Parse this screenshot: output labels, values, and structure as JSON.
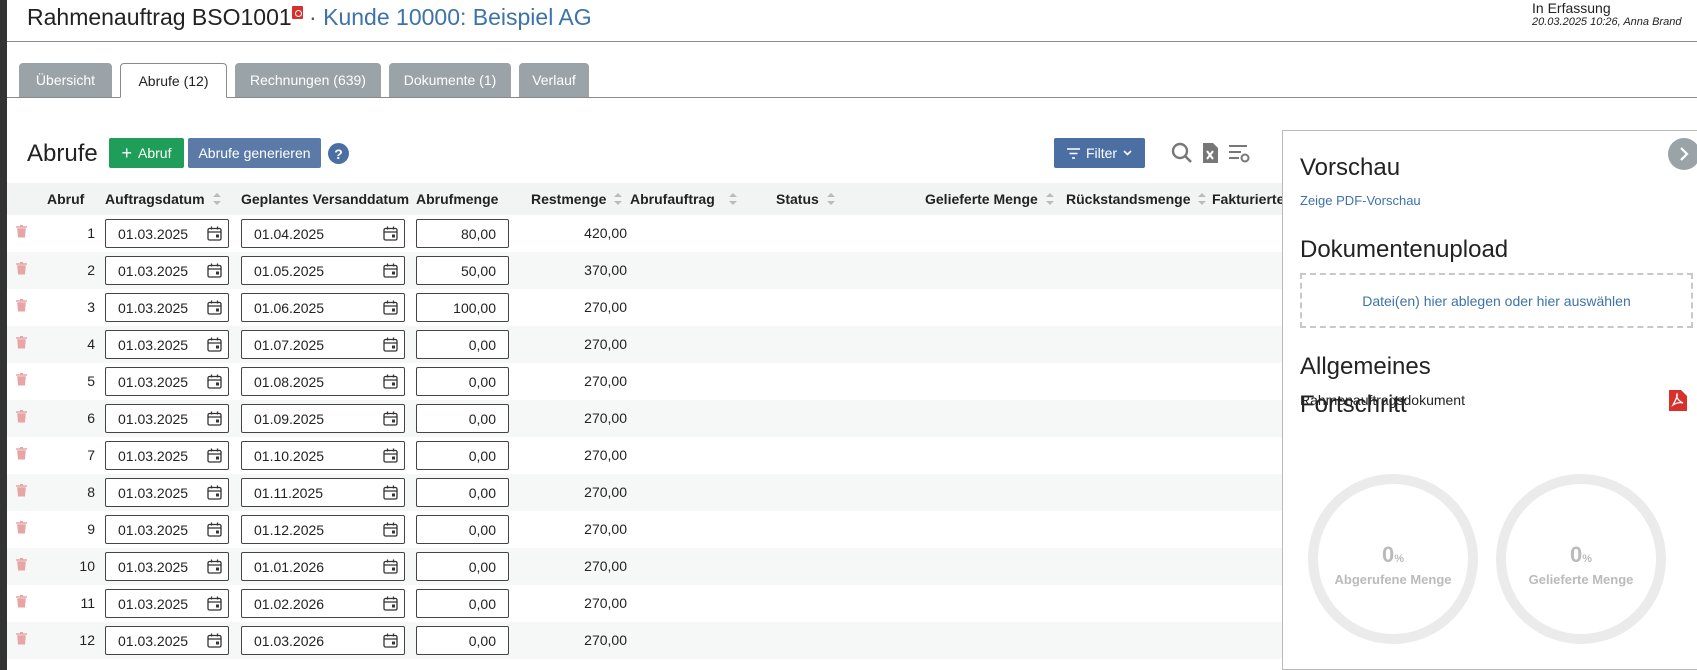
{
  "header": {
    "title": "Rahmenauftrag BSO1001",
    "separator": " · ",
    "customer": "Kunde 10000: Beispiel AG",
    "status": "In Erfassung",
    "meta": "20.03.2025 10:26, Anna Brand"
  },
  "tabs": [
    {
      "label": "Übersicht",
      "active": false
    },
    {
      "label": "Abrufe (12)",
      "active": true
    },
    {
      "label": "Rechnungen (639)",
      "active": false
    },
    {
      "label": "Dokumente (1)",
      "active": false
    },
    {
      "label": "Verlauf",
      "active": false
    }
  ],
  "toolbar": {
    "section_title": "Abrufe",
    "add_label": "Abruf",
    "generate_label": "Abrufe generieren",
    "help_label": "?",
    "filter_label": "Filter"
  },
  "table": {
    "columns": [
      "Abruf",
      "Auftragsdatum",
      "Geplantes Versanddatum",
      "Abrufmenge",
      "Restmenge",
      "Abrufauftrag",
      "Status",
      "Gelieferte Menge",
      "Rückstandsmenge",
      "Fakturierte"
    ],
    "rows": [
      {
        "nr": "1",
        "auftragsdatum": "01.03.2025",
        "versanddatum": "01.04.2025",
        "abrufmenge": "80,00",
        "restmenge": "420,00"
      },
      {
        "nr": "2",
        "auftragsdatum": "01.03.2025",
        "versanddatum": "01.05.2025",
        "abrufmenge": "50,00",
        "restmenge": "370,00"
      },
      {
        "nr": "3",
        "auftragsdatum": "01.03.2025",
        "versanddatum": "01.06.2025",
        "abrufmenge": "100,00",
        "restmenge": "270,00"
      },
      {
        "nr": "4",
        "auftragsdatum": "01.03.2025",
        "versanddatum": "01.07.2025",
        "abrufmenge": "0,00",
        "restmenge": "270,00"
      },
      {
        "nr": "5",
        "auftragsdatum": "01.03.2025",
        "versanddatum": "01.08.2025",
        "abrufmenge": "0,00",
        "restmenge": "270,00"
      },
      {
        "nr": "6",
        "auftragsdatum": "01.03.2025",
        "versanddatum": "01.09.2025",
        "abrufmenge": "0,00",
        "restmenge": "270,00"
      },
      {
        "nr": "7",
        "auftragsdatum": "01.03.2025",
        "versanddatum": "01.10.2025",
        "abrufmenge": "0,00",
        "restmenge": "270,00"
      },
      {
        "nr": "8",
        "auftragsdatum": "01.03.2025",
        "versanddatum": "01.11.2025",
        "abrufmenge": "0,00",
        "restmenge": "270,00"
      },
      {
        "nr": "9",
        "auftragsdatum": "01.03.2025",
        "versanddatum": "01.12.2025",
        "abrufmenge": "0,00",
        "restmenge": "270,00"
      },
      {
        "nr": "10",
        "auftragsdatum": "01.03.2025",
        "versanddatum": "01.01.2026",
        "abrufmenge": "0,00",
        "restmenge": "270,00"
      },
      {
        "nr": "11",
        "auftragsdatum": "01.03.2025",
        "versanddatum": "01.02.2026",
        "abrufmenge": "0,00",
        "restmenge": "270,00"
      },
      {
        "nr": "12",
        "auftragsdatum": "01.03.2025",
        "versanddatum": "01.03.2026",
        "abrufmenge": "0,00",
        "restmenge": "270,00"
      }
    ]
  },
  "panel": {
    "preview_title": "Vorschau",
    "preview_link": "Zeige PDF-Vorschau",
    "upload_title": "Dokumentenupload",
    "upload_text": "Datei(en) hier ablegen oder hier auswählen",
    "general_title": "Allgemeines",
    "general_doc": "Rahmenauftragsdokument",
    "progress_title": "Fortschritt",
    "progress": [
      {
        "value": "0",
        "unit": "%",
        "label": "Abgerufene Menge"
      },
      {
        "value": "0",
        "unit": "%",
        "label": "Gelieferte Menge"
      }
    ]
  },
  "colors": {
    "accent_green": "#1e9e58",
    "accent_blue": "#4b6fa3",
    "link": "#3d73a8",
    "tab_inactive": "#9aa3a7",
    "pdf_red": "#d9302c"
  }
}
